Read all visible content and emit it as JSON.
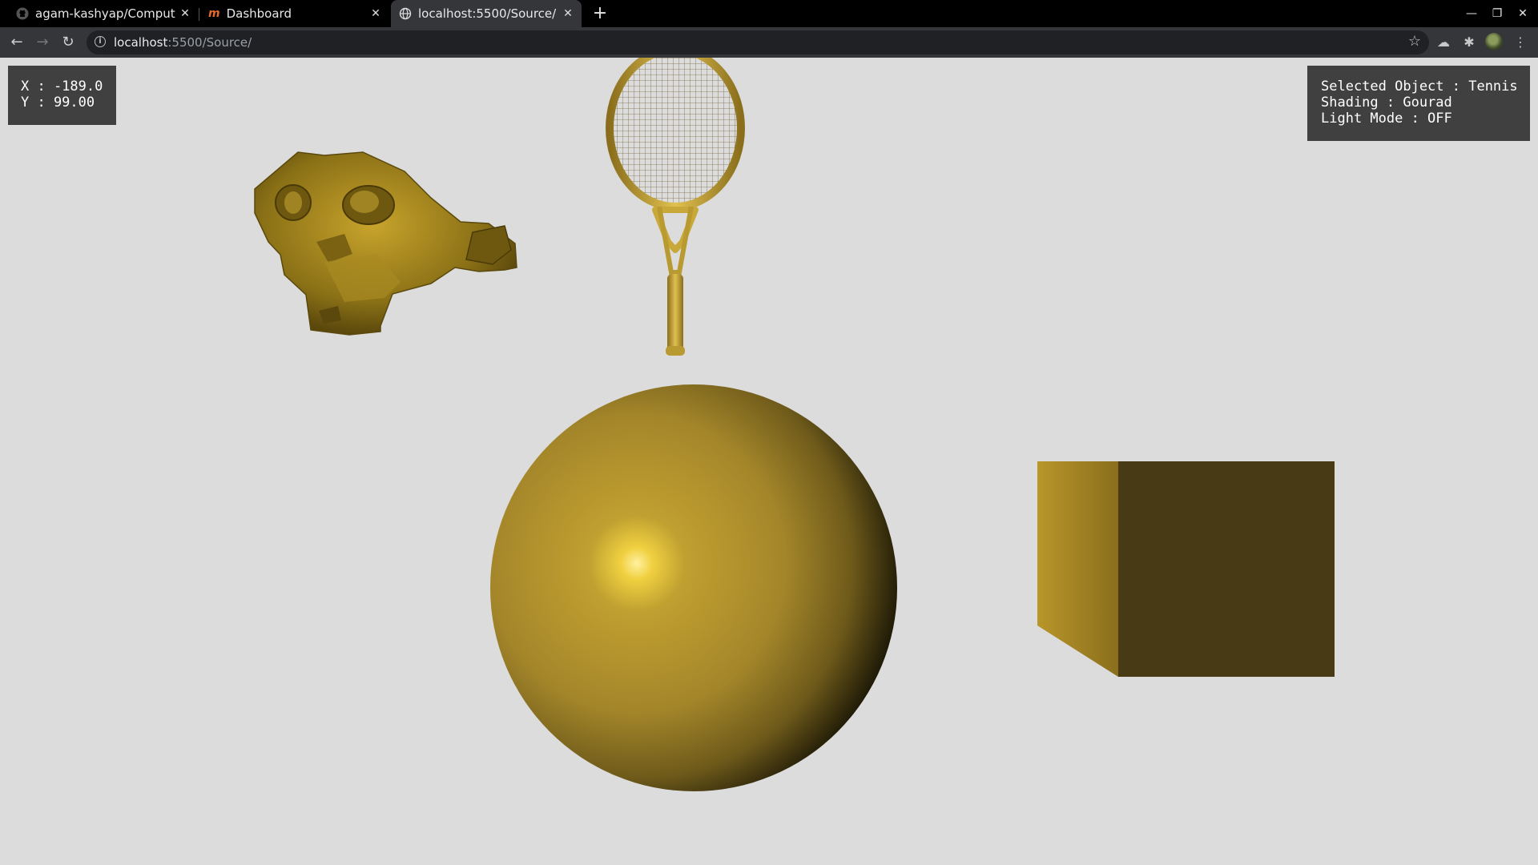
{
  "browser": {
    "tabs": [
      {
        "label": "agam-kashyap/Computer",
        "icon": "github-icon",
        "active": false
      },
      {
        "label": "Dashboard",
        "icon": "dashboard-logo-icon",
        "active": false
      },
      {
        "label": "localhost:5500/Source/",
        "icon": "globe-icon",
        "active": true
      }
    ],
    "url_host": "localhost",
    "url_rest": ":5500/Source/"
  },
  "hud": {
    "x_line": "X : -189.0",
    "y_line": "Y : 99.00",
    "selected_line": "Selected Object : Tennis",
    "shading_line": "Shading : Gourad",
    "light_line": "Light Mode : OFF"
  },
  "scene": {
    "objects": [
      "monkey-head",
      "tennis-racket",
      "sphere",
      "cube"
    ],
    "material_color": "#b8982a",
    "background_color": "#dcdcdc"
  }
}
